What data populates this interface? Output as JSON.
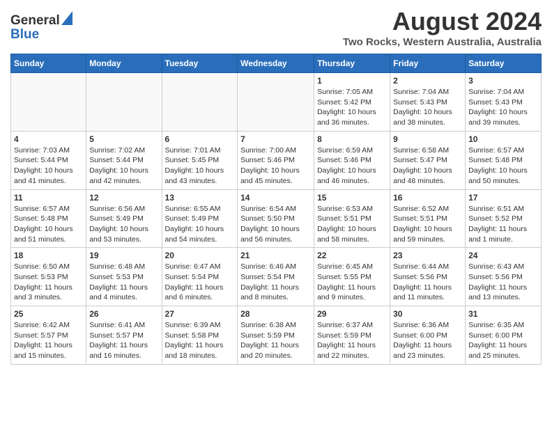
{
  "header": {
    "logo_general": "General",
    "logo_blue": "Blue",
    "title": "August 2024",
    "subtitle": "Two Rocks, Western Australia, Australia"
  },
  "days_of_week": [
    "Sunday",
    "Monday",
    "Tuesday",
    "Wednesday",
    "Thursday",
    "Friday",
    "Saturday"
  ],
  "weeks": [
    [
      {
        "day": "",
        "info": ""
      },
      {
        "day": "",
        "info": ""
      },
      {
        "day": "",
        "info": ""
      },
      {
        "day": "",
        "info": ""
      },
      {
        "day": "1",
        "info": "Sunrise: 7:05 AM\nSunset: 5:42 PM\nDaylight: 10 hours\nand 36 minutes."
      },
      {
        "day": "2",
        "info": "Sunrise: 7:04 AM\nSunset: 5:43 PM\nDaylight: 10 hours\nand 38 minutes."
      },
      {
        "day": "3",
        "info": "Sunrise: 7:04 AM\nSunset: 5:43 PM\nDaylight: 10 hours\nand 39 minutes."
      }
    ],
    [
      {
        "day": "4",
        "info": "Sunrise: 7:03 AM\nSunset: 5:44 PM\nDaylight: 10 hours\nand 41 minutes."
      },
      {
        "day": "5",
        "info": "Sunrise: 7:02 AM\nSunset: 5:44 PM\nDaylight: 10 hours\nand 42 minutes."
      },
      {
        "day": "6",
        "info": "Sunrise: 7:01 AM\nSunset: 5:45 PM\nDaylight: 10 hours\nand 43 minutes."
      },
      {
        "day": "7",
        "info": "Sunrise: 7:00 AM\nSunset: 5:46 PM\nDaylight: 10 hours\nand 45 minutes."
      },
      {
        "day": "8",
        "info": "Sunrise: 6:59 AM\nSunset: 5:46 PM\nDaylight: 10 hours\nand 46 minutes."
      },
      {
        "day": "9",
        "info": "Sunrise: 6:58 AM\nSunset: 5:47 PM\nDaylight: 10 hours\nand 48 minutes."
      },
      {
        "day": "10",
        "info": "Sunrise: 6:57 AM\nSunset: 5:48 PM\nDaylight: 10 hours\nand 50 minutes."
      }
    ],
    [
      {
        "day": "11",
        "info": "Sunrise: 6:57 AM\nSunset: 5:48 PM\nDaylight: 10 hours\nand 51 minutes."
      },
      {
        "day": "12",
        "info": "Sunrise: 6:56 AM\nSunset: 5:49 PM\nDaylight: 10 hours\nand 53 minutes."
      },
      {
        "day": "13",
        "info": "Sunrise: 6:55 AM\nSunset: 5:49 PM\nDaylight: 10 hours\nand 54 minutes."
      },
      {
        "day": "14",
        "info": "Sunrise: 6:54 AM\nSunset: 5:50 PM\nDaylight: 10 hours\nand 56 minutes."
      },
      {
        "day": "15",
        "info": "Sunrise: 6:53 AM\nSunset: 5:51 PM\nDaylight: 10 hours\nand 58 minutes."
      },
      {
        "day": "16",
        "info": "Sunrise: 6:52 AM\nSunset: 5:51 PM\nDaylight: 10 hours\nand 59 minutes."
      },
      {
        "day": "17",
        "info": "Sunrise: 6:51 AM\nSunset: 5:52 PM\nDaylight: 11 hours\nand 1 minute."
      }
    ],
    [
      {
        "day": "18",
        "info": "Sunrise: 6:50 AM\nSunset: 5:53 PM\nDaylight: 11 hours\nand 3 minutes."
      },
      {
        "day": "19",
        "info": "Sunrise: 6:48 AM\nSunset: 5:53 PM\nDaylight: 11 hours\nand 4 minutes."
      },
      {
        "day": "20",
        "info": "Sunrise: 6:47 AM\nSunset: 5:54 PM\nDaylight: 11 hours\nand 6 minutes."
      },
      {
        "day": "21",
        "info": "Sunrise: 6:46 AM\nSunset: 5:54 PM\nDaylight: 11 hours\nand 8 minutes."
      },
      {
        "day": "22",
        "info": "Sunrise: 6:45 AM\nSunset: 5:55 PM\nDaylight: 11 hours\nand 9 minutes."
      },
      {
        "day": "23",
        "info": "Sunrise: 6:44 AM\nSunset: 5:56 PM\nDaylight: 11 hours\nand 11 minutes."
      },
      {
        "day": "24",
        "info": "Sunrise: 6:43 AM\nSunset: 5:56 PM\nDaylight: 11 hours\nand 13 minutes."
      }
    ],
    [
      {
        "day": "25",
        "info": "Sunrise: 6:42 AM\nSunset: 5:57 PM\nDaylight: 11 hours\nand 15 minutes."
      },
      {
        "day": "26",
        "info": "Sunrise: 6:41 AM\nSunset: 5:57 PM\nDaylight: 11 hours\nand 16 minutes."
      },
      {
        "day": "27",
        "info": "Sunrise: 6:39 AM\nSunset: 5:58 PM\nDaylight: 11 hours\nand 18 minutes."
      },
      {
        "day": "28",
        "info": "Sunrise: 6:38 AM\nSunset: 5:59 PM\nDaylight: 11 hours\nand 20 minutes."
      },
      {
        "day": "29",
        "info": "Sunrise: 6:37 AM\nSunset: 5:59 PM\nDaylight: 11 hours\nand 22 minutes."
      },
      {
        "day": "30",
        "info": "Sunrise: 6:36 AM\nSunset: 6:00 PM\nDaylight: 11 hours\nand 23 minutes."
      },
      {
        "day": "31",
        "info": "Sunrise: 6:35 AM\nSunset: 6:00 PM\nDaylight: 11 hours\nand 25 minutes."
      }
    ]
  ]
}
